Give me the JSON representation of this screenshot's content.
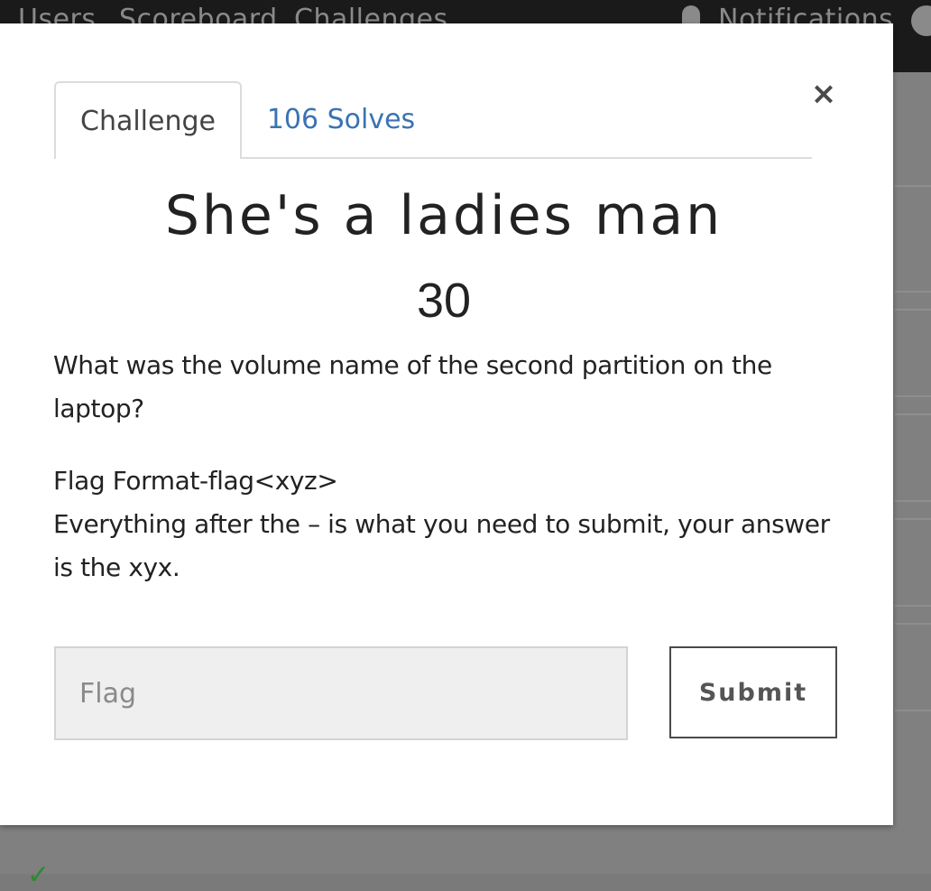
{
  "nav": {
    "links": [
      "Users",
      "Scoreboard",
      "Challenges"
    ],
    "notifications": "Notifications"
  },
  "modal": {
    "close_label": "×",
    "tabs": [
      {
        "label": "Challenge",
        "active": true
      },
      {
        "label": "106 Solves",
        "active": false
      }
    ],
    "title": "She's a ladies man",
    "value": "30",
    "description": [
      "What was the volume name of the second partition on the laptop?",
      "Flag Format-flag<xyz>\nEverything after the – is what you need to submit, your answer is the xyx."
    ],
    "flag_input": {
      "placeholder": "Flag",
      "value": ""
    },
    "submit_label": "Submit"
  },
  "colors": {
    "link_blue": "#3b73b3",
    "nav_background": "#1a1a1a",
    "overlay_gray": "#808080",
    "input_background": "#efefef"
  },
  "icons": [
    "close-icon",
    "bell-icon",
    "user-icon",
    "checkmark-icon"
  ]
}
